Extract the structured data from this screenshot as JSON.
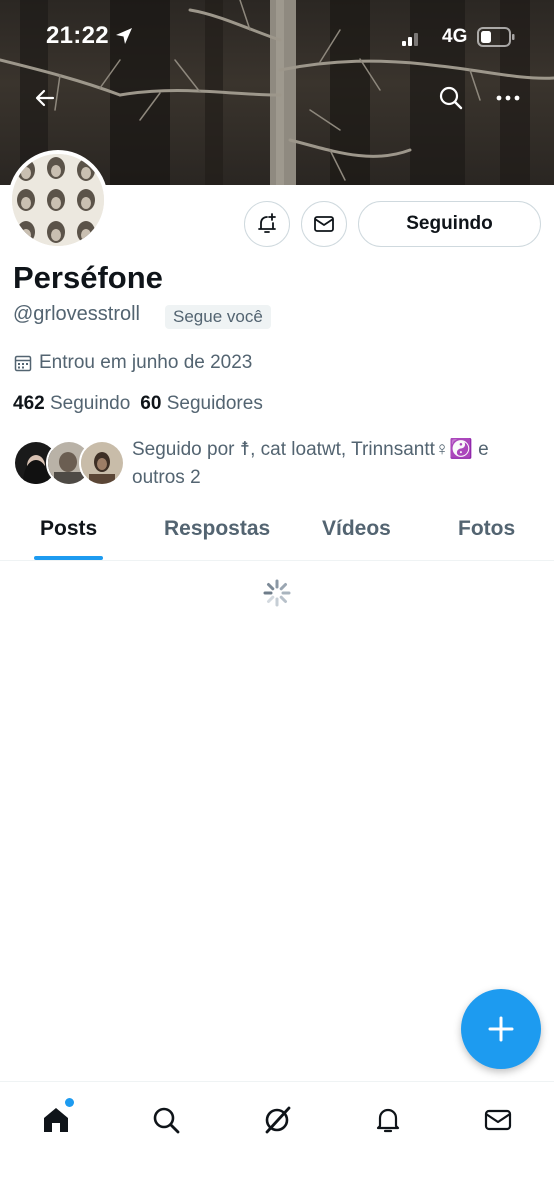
{
  "status_bar": {
    "time": "21:22",
    "network": "4G"
  },
  "header": {
    "back_icon": "arrow-left-icon",
    "search_icon": "search-icon",
    "more_icon": "more-horizontal-icon"
  },
  "profile": {
    "display_name": "Perséfone",
    "handle": "@grlovesstroll",
    "follows_you_badge": "Segue você",
    "joined": "Entrou em junho de 2023",
    "following_count": "462",
    "following_label": "Seguindo",
    "followers_count": "60",
    "followers_label": "Seguidores",
    "followed_by_text": "Seguido por ☨, cat loatwt, Trinnsantt♀☯️ e outros 2"
  },
  "actions": {
    "notify_icon": "bell-plus-icon",
    "dm_icon": "mail-icon",
    "follow_button_label": "Seguindo"
  },
  "tabs": [
    {
      "label": "Posts",
      "active": true
    },
    {
      "label": "Respostas",
      "active": false
    },
    {
      "label": "Vídeos",
      "active": false
    },
    {
      "label": "Fotos",
      "active": false
    }
  ],
  "fab": {
    "icon": "plus-icon"
  },
  "bottom_nav": [
    {
      "icon": "home-icon",
      "has_dot": true
    },
    {
      "icon": "search-icon"
    },
    {
      "icon": "grok-icon"
    },
    {
      "icon": "bell-icon"
    },
    {
      "icon": "mail-icon"
    }
  ],
  "colors": {
    "accent": "#1d9bf0",
    "text_primary": "#0f1419",
    "text_secondary": "#536471",
    "border": "#cfd9de"
  }
}
